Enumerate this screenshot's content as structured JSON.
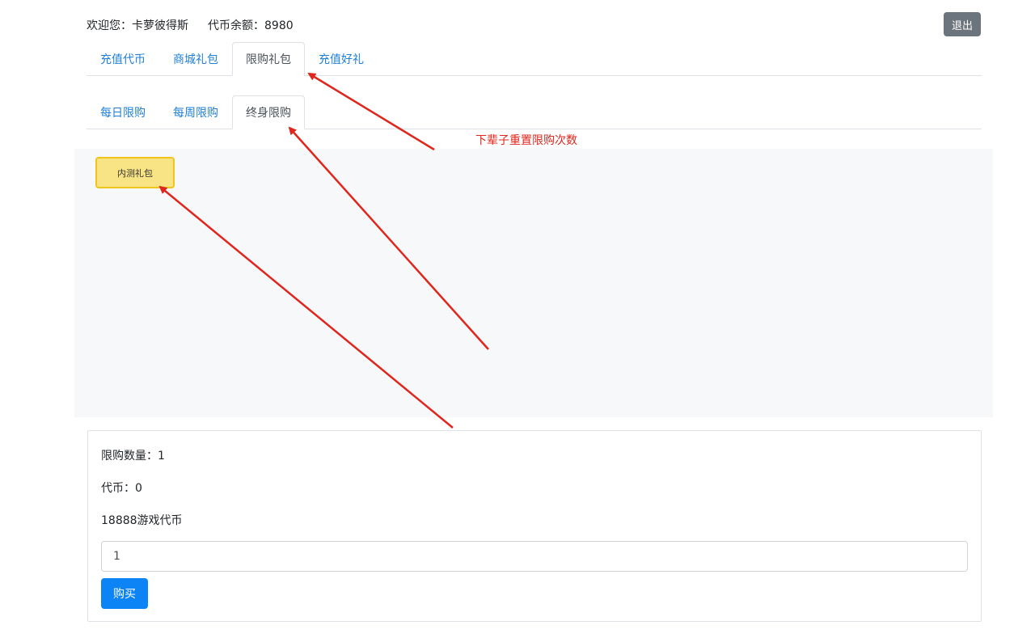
{
  "header": {
    "welcome": "欢迎您：卡萝彼得斯",
    "balance": "代币余额：8980",
    "logout_label": "退出"
  },
  "main_tabs": [
    {
      "label": "充值代币",
      "active": false
    },
    {
      "label": "商城礼包",
      "active": false
    },
    {
      "label": "限购礼包",
      "active": true
    },
    {
      "label": "充值好礼",
      "active": false
    }
  ],
  "sub_tabs": [
    {
      "label": "每日限购",
      "active": false
    },
    {
      "label": "每周限购",
      "active": false
    },
    {
      "label": "终身限购",
      "active": true
    }
  ],
  "gift": {
    "label": "内测礼包"
  },
  "annotation": {
    "text": "下辈子重置限购次数",
    "color": "#e0261c"
  },
  "detail": {
    "limit": "限购数量：1",
    "coins": "代币：0",
    "description": "18888游戏代币",
    "quantity_value": "1",
    "buy_label": "购买"
  },
  "colors": {
    "link": "#1e7fd6",
    "primary": "#0d84f5",
    "secondary": "#6c757d",
    "gift_fill": "#f8e484",
    "gift_border": "#f0c419",
    "arrow": "#e0261c"
  }
}
